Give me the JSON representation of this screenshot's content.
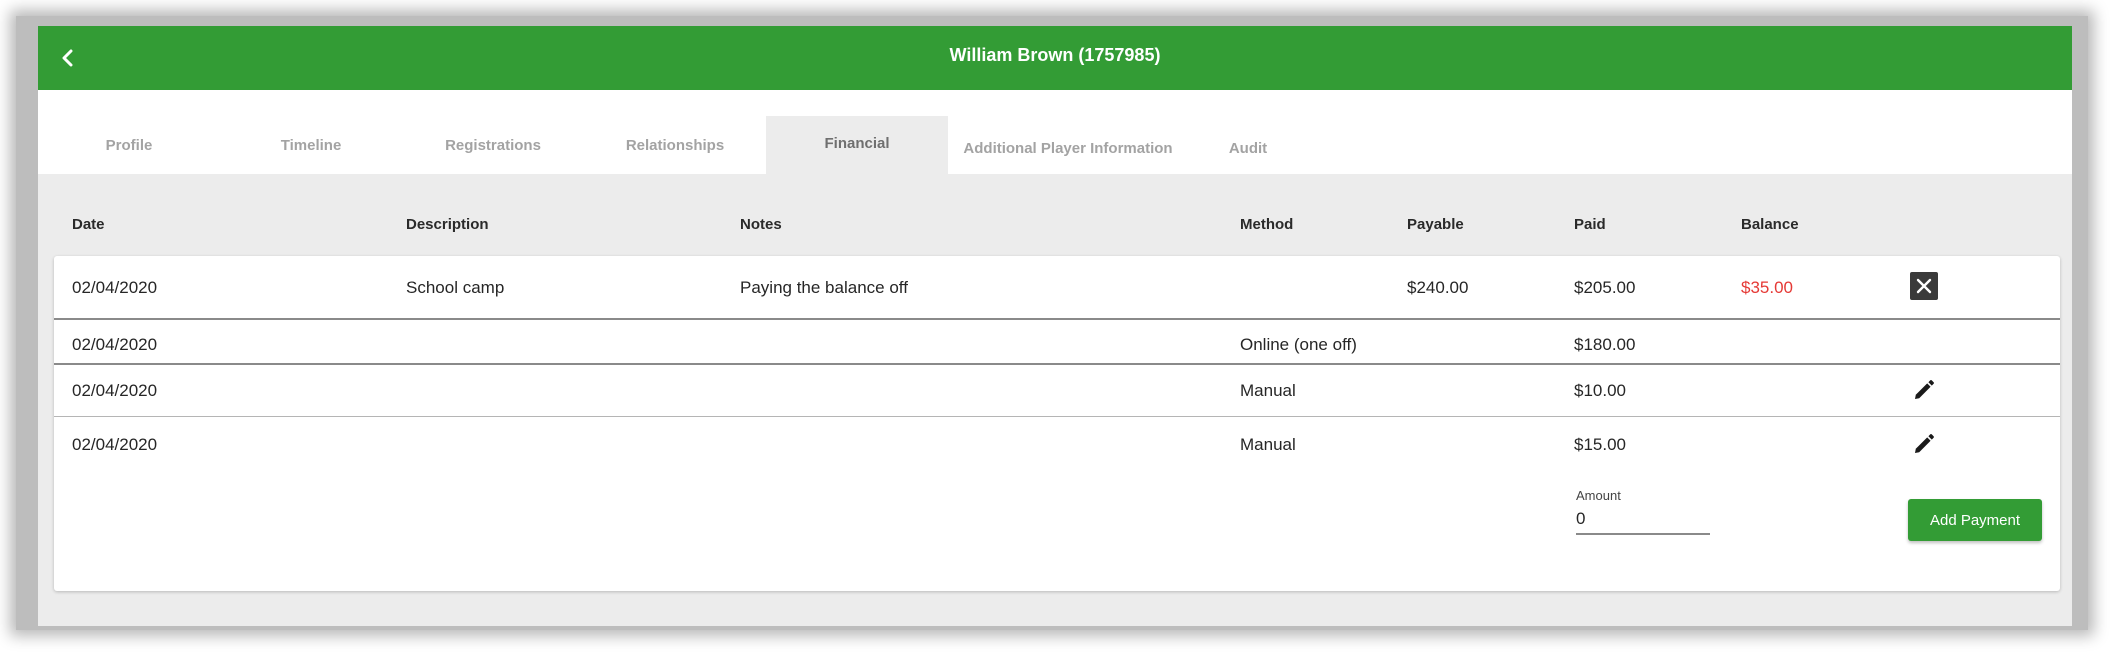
{
  "header": {
    "title": "William Brown (1757985)",
    "back_icon": "chevron-left-icon"
  },
  "tabs": [
    {
      "label": "Profile"
    },
    {
      "label": "Timeline"
    },
    {
      "label": "Registrations"
    },
    {
      "label": "Relationships"
    },
    {
      "label": "Financial",
      "active": true
    },
    {
      "label": "Additional Player Information"
    },
    {
      "label": "Audit"
    }
  ],
  "table": {
    "columns": {
      "date": "Date",
      "description": "Description",
      "notes": "Notes",
      "method": "Method",
      "payable": "Payable",
      "paid": "Paid",
      "balance": "Balance"
    },
    "summary": {
      "date": "02/04/2020",
      "description": "School camp",
      "notes": "Paying the balance off",
      "method": "",
      "payable": "$240.00",
      "paid": "$205.00",
      "balance": "$35.00",
      "action_icon": "close-icon"
    },
    "payments": [
      {
        "date": "02/04/2020",
        "method": "Online (one off)",
        "paid": "$180.00"
      },
      {
        "date": "02/04/2020",
        "method": "Manual",
        "paid": "$10.00",
        "action_icon": "edit-icon"
      },
      {
        "date": "02/04/2020",
        "method": "Manual",
        "paid": "$15.00",
        "action_icon": "edit-icon"
      }
    ]
  },
  "payment_form": {
    "amount_label": "Amount",
    "amount_value": "0",
    "submit_label": "Add Payment"
  },
  "colors": {
    "brand_green": "#339c35",
    "balance_red": "#e53935"
  }
}
